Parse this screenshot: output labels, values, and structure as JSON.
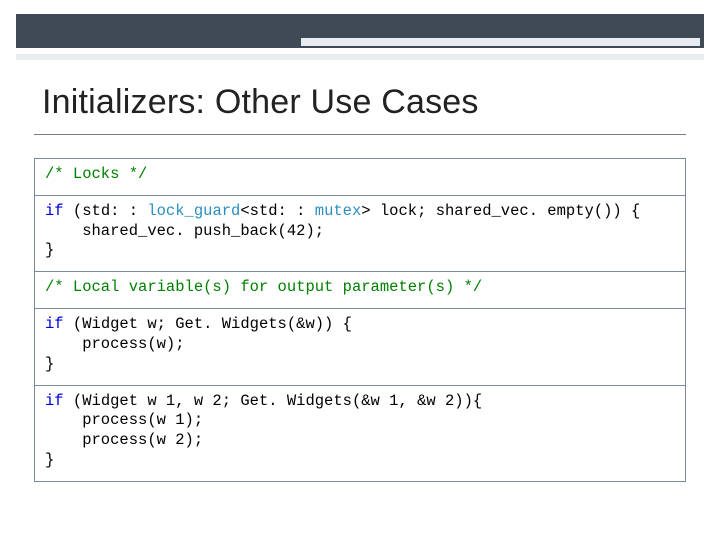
{
  "slide": {
    "title": "Initializers: Other Use Cases"
  },
  "code": {
    "row1": "/* Locks */",
    "row2a": "if",
    "row2b": " (std: : ",
    "row2c": "lock_guard",
    "row2d": "<std: : ",
    "row2e": "mutex",
    "row2f": "> lock; shared_vec. empty()) {",
    "row2g": "    shared_vec. push_back(42);",
    "row2h": "}",
    "row3": "/* Local variable(s) for output parameter(s) */",
    "row4a": "if",
    "row4b": " (Widget w; Get. Widgets(&w)) {",
    "row4c": "    process(w);",
    "row4d": "}",
    "row5a": "if",
    "row5b": " (Widget w 1, w 2; Get. Widgets(&w 1, &w 2)){",
    "row5c": "    process(w 1);",
    "row5d": "    process(w 2);",
    "row5e": "}"
  }
}
